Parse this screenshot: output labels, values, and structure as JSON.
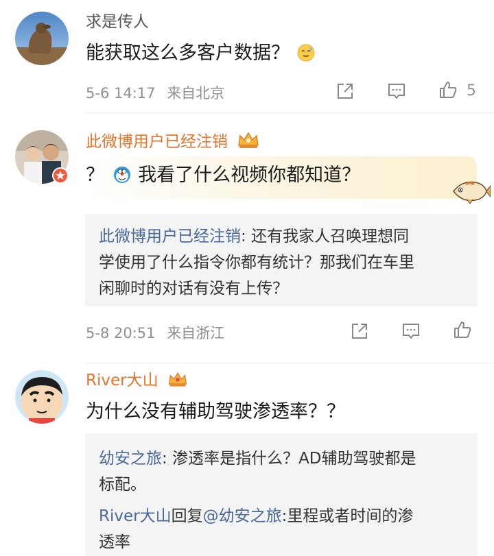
{
  "comments": [
    {
      "username": "求是传人",
      "text": "能获取这么多客户数据？",
      "emoji": "sweat-smile-emoji",
      "time": "5-6 14:17",
      "location": "来自北京",
      "like_count": "5"
    },
    {
      "username": "此微博用户已经注销",
      "text_prefix": "？",
      "text": "我看了什么视频你都知道？",
      "time": "5-8 20:51",
      "location": "来自浙江",
      "replies": [
        {
          "name": "此微博用户已经注销",
          "sep": ": ",
          "lines": [
            "还有我家人召唤理想同",
            "学使用了什么指令你都有统计？那我们在车里",
            "闲聊时的对话有没有上传？"
          ]
        }
      ]
    },
    {
      "username": "River大山",
      "text": "为什么没有辅助驾驶渗透率？？",
      "replies": [
        {
          "name": "幼安之旅",
          "sep": ": ",
          "lines": [
            "渗透率是指什么？AD辅助驾驶都是",
            "标配。"
          ]
        },
        {
          "name": "River大山",
          "reply_word": "回复",
          "mention": "@幼安之旅",
          "sep": ":",
          "lines": [
            "里程或者时间的渗",
            "透率"
          ]
        }
      ]
    }
  ],
  "colors": {
    "username_plain": "#555555",
    "username_vip": "#e8732b",
    "reply_name": "#49699b",
    "meta_gray": "#8f8f8f",
    "reply_bg": "#f4f4f4"
  }
}
